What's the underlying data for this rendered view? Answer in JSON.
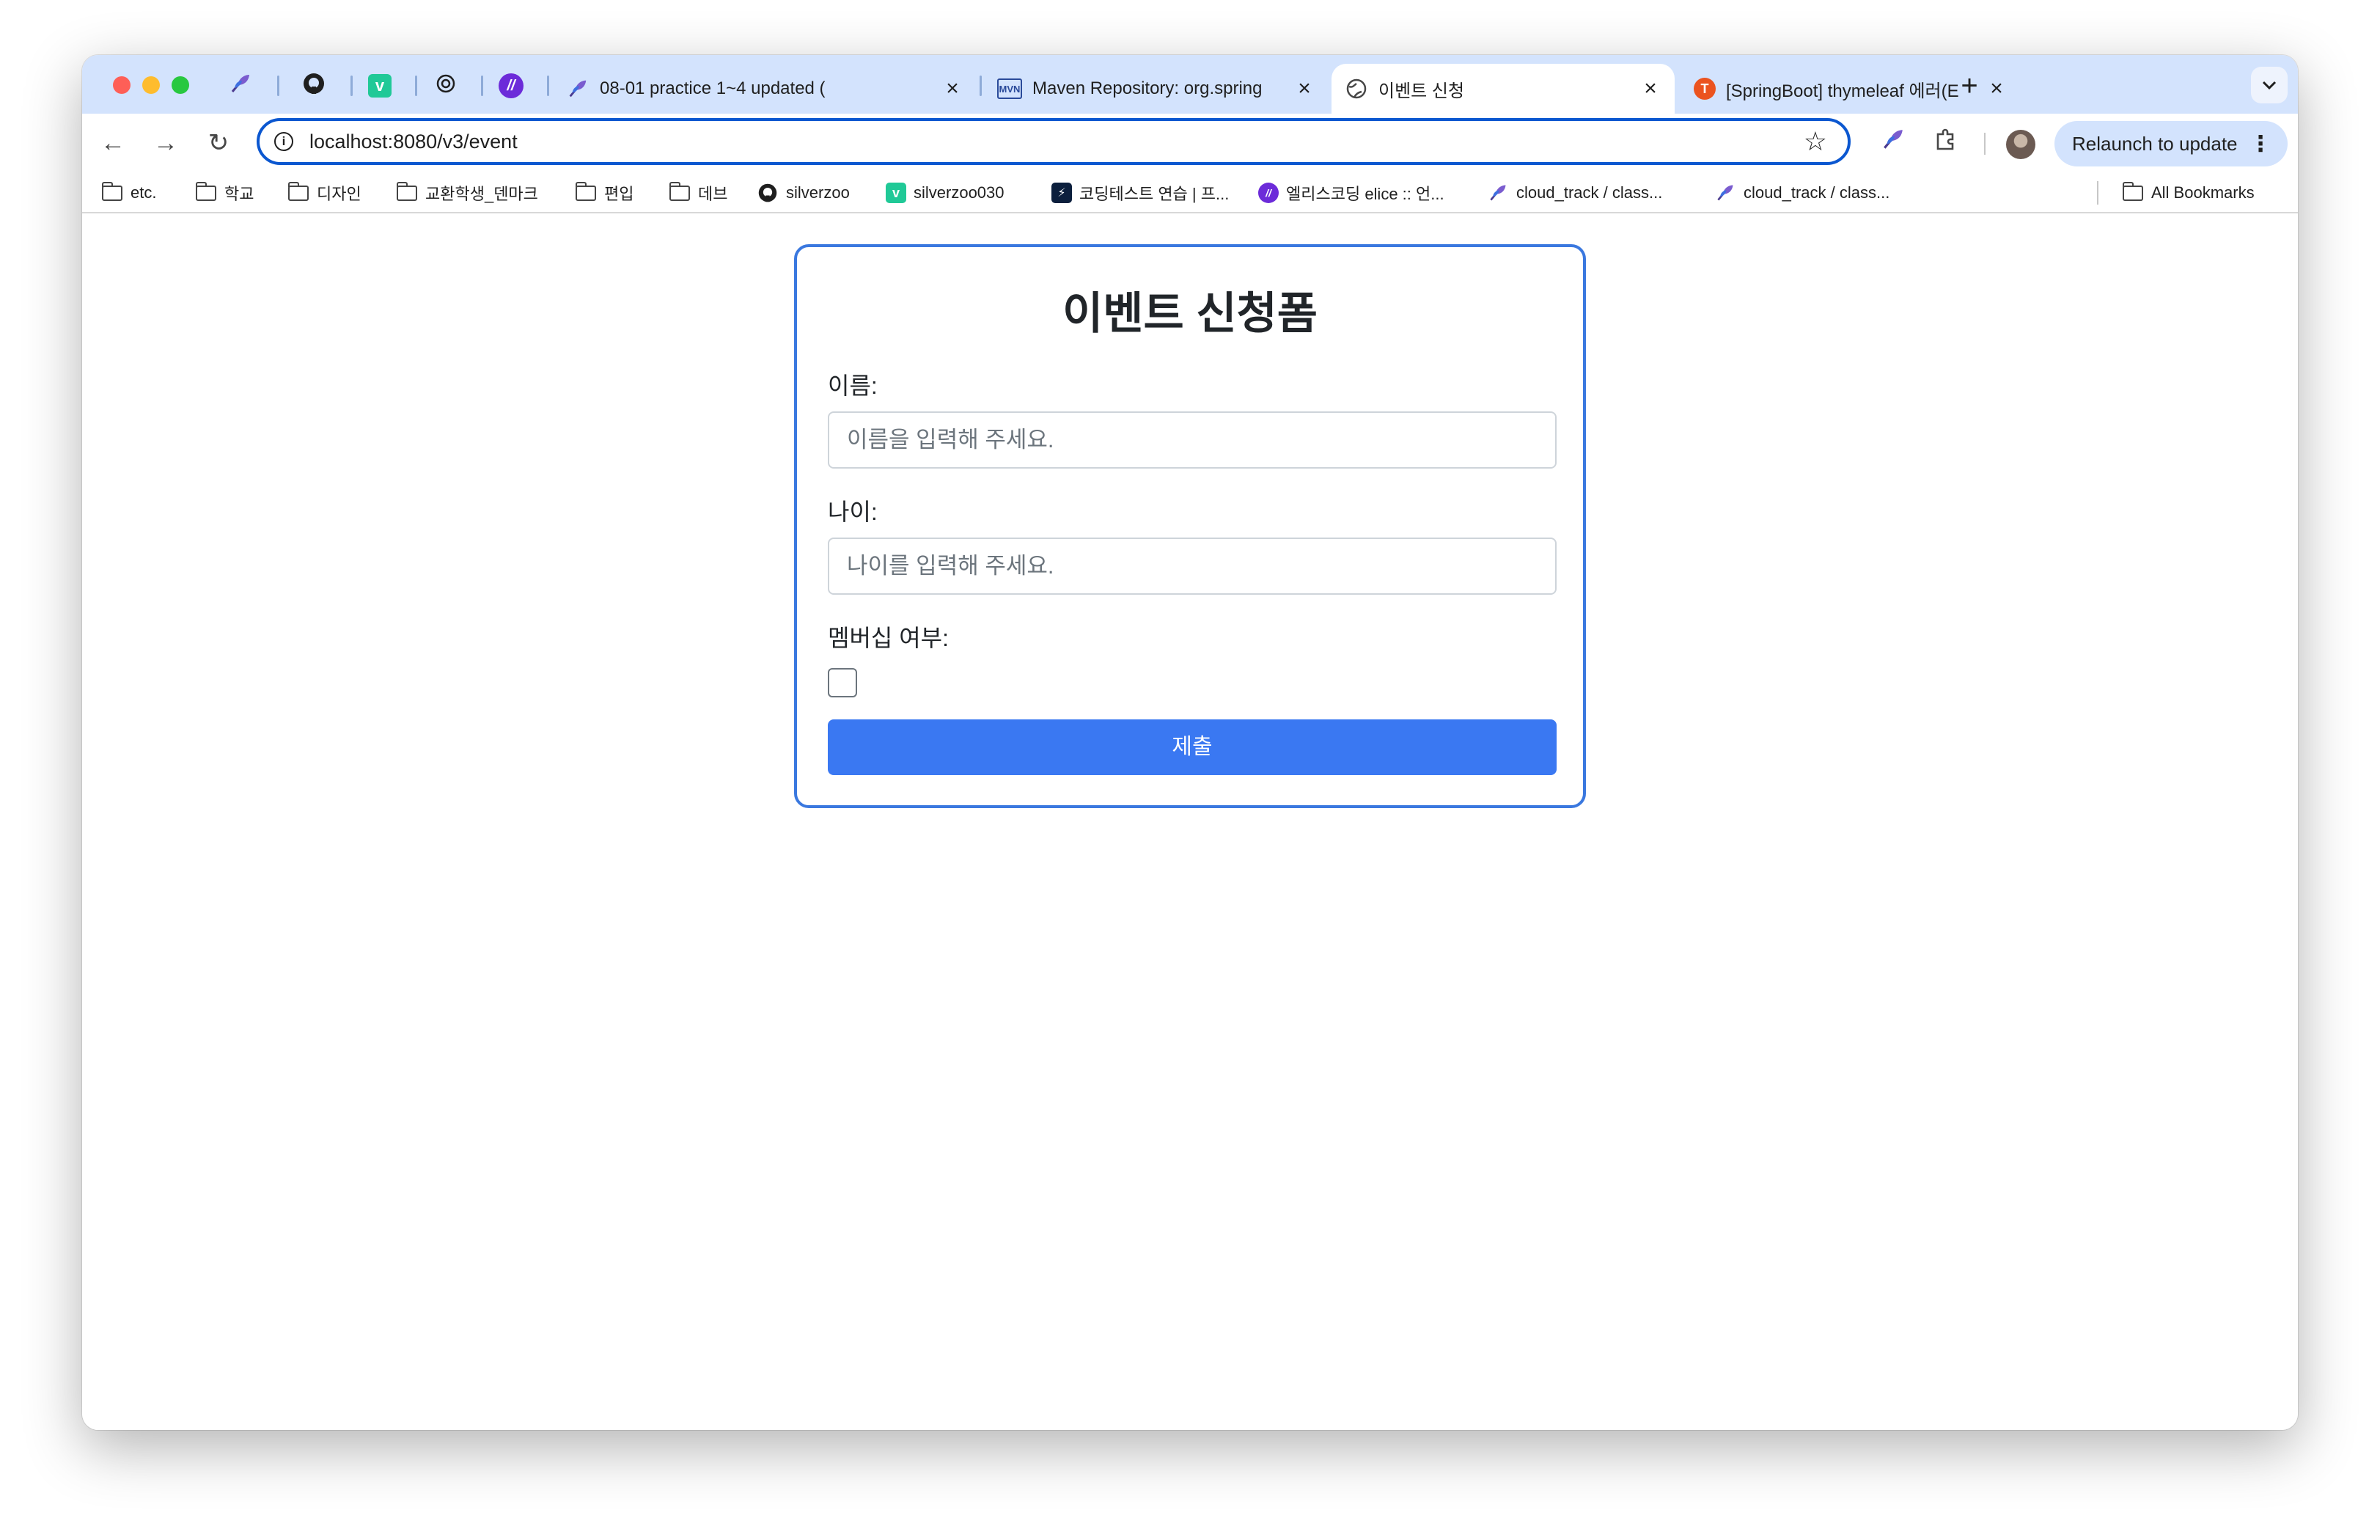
{
  "window": {
    "pinned_tabs": [
      {
        "icon": "feather-icon"
      },
      {
        "icon": "github-icon"
      },
      {
        "icon": "v-logo-icon"
      },
      {
        "icon": "openai-icon"
      },
      {
        "icon": "elice-icon"
      }
    ],
    "tabs": [
      {
        "title": "08-01 practice 1~4 updated (",
        "icon": "feather-icon",
        "active": false
      },
      {
        "title": "Maven Repository: org.spring",
        "icon": "mvn-icon",
        "favicon_text": "MVN",
        "active": false
      },
      {
        "title": "이벤트 신청",
        "icon": "globe-icon",
        "active": true
      },
      {
        "title": "[SpringBoot] thymeleaf 에러(E",
        "icon": "tistory-icon",
        "favicon_text": "T",
        "active": false
      }
    ]
  },
  "toolbar": {
    "url": "localhost:8080/v3/event",
    "relaunch_label": "Relaunch to update"
  },
  "bookmarks": {
    "items": [
      {
        "label": "etc.",
        "icon": "folder-icon"
      },
      {
        "label": "학교",
        "icon": "folder-icon"
      },
      {
        "label": "디자인",
        "icon": "folder-icon"
      },
      {
        "label": "교환학생_덴마크",
        "icon": "folder-icon"
      },
      {
        "label": "편입",
        "icon": "folder-icon"
      },
      {
        "label": "데브",
        "icon": "folder-icon"
      },
      {
        "label": "silverzoo",
        "icon": "github-icon"
      },
      {
        "label": "silverzoo030",
        "icon": "v-logo-icon"
      },
      {
        "label": "코딩테스트 연습 | 프...",
        "icon": "programmers-icon"
      },
      {
        "label": "엘리스코딩 elice :: 언...",
        "icon": "elice-icon"
      },
      {
        "label": "cloud_track / class...",
        "icon": "feather-icon"
      },
      {
        "label": "cloud_track / class...",
        "icon": "feather-icon"
      }
    ],
    "all_bookmarks": "All Bookmarks"
  },
  "form": {
    "title": "이벤트 신청폼",
    "name_label": "이름:",
    "name_placeholder": "이름을 입력해 주세요.",
    "age_label": "나이:",
    "age_placeholder": "나이를 입력해 주세요.",
    "membership_label": "멤버십 여부:",
    "membership_checked": false,
    "submit_label": "제출"
  },
  "colors": {
    "tab_strip": "#d3e3fd",
    "omnibox_border": "#0b57d0",
    "card_border": "#3a78df",
    "submit_button": "#3a78f2"
  }
}
